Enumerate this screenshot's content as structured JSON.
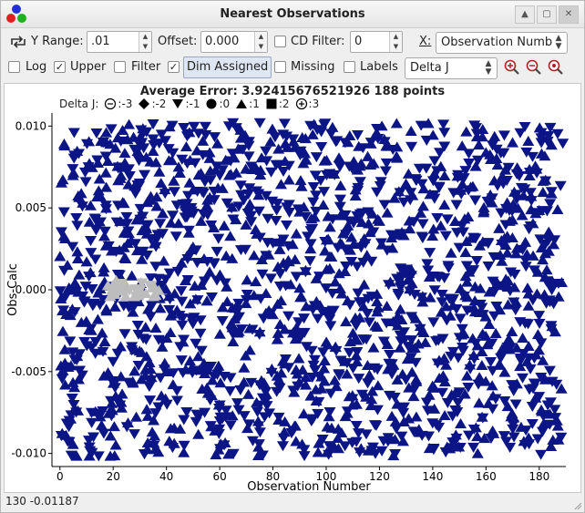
{
  "window": {
    "title": "Nearest Observations",
    "controls": [
      "minimize",
      "maximize",
      "close"
    ]
  },
  "toolbar1": {
    "y_range_label": "Y Range:",
    "y_range_value": ".01",
    "offset_label": "Offset:",
    "offset_value": "0.000",
    "cd_filter_label": "CD Filter:",
    "cd_filter_checked": false,
    "cd_filter_value": "0",
    "x_label": "X:",
    "x_value": "Observation Numb"
  },
  "toolbar2": {
    "log_label": "Log",
    "log_checked": false,
    "upper_label": "Upper",
    "upper_checked": true,
    "filter_label": "Filter",
    "filter_checked": false,
    "dim_label": "Dim Assigned",
    "dim_checked": true,
    "missing_label": "Missing",
    "missing_checked": false,
    "labels_label": "Labels",
    "labels_checked": false,
    "group_value": "Delta J"
  },
  "plot": {
    "header": "Average Error: 3.92415676521926  188 points",
    "legend_title": "Delta J:",
    "legend": [
      {
        "symbol": "circle-minus",
        "label": ":-3"
      },
      {
        "symbol": "diamond",
        "label": ":-2"
      },
      {
        "symbol": "triangle-down",
        "label": ":-1"
      },
      {
        "symbol": "circle",
        "label": ":0"
      },
      {
        "symbol": "triangle-up",
        "label": ":1"
      },
      {
        "symbol": "square",
        "label": ":2"
      },
      {
        "symbol": "circle-plus",
        "label": ":3"
      }
    ]
  },
  "chart_data": {
    "type": "scatter",
    "xlabel": "Observation Number",
    "ylabel": "Obs-Calc",
    "xlim": [
      -3,
      190
    ],
    "ylim": [
      -0.0108,
      0.0108
    ],
    "x_ticks": [
      0,
      20,
      40,
      60,
      80,
      100,
      120,
      140,
      160,
      180
    ],
    "y_ticks": [
      0.01,
      0.005,
      0.0,
      -0.005,
      -0.01
    ],
    "y_tick_labels": [
      "0.010",
      "0.005",
      "0.000",
      "-0.005",
      "-0.010"
    ],
    "point_count": 188,
    "series_colors": {
      "unassigned": "#0b1585",
      "assigned_dim": "#bdbdbd"
    },
    "series": [
      {
        "symbol": "triangle-down",
        "values_summary": "dense field of points spanning x 0-188 and y -0.010 to 0.010"
      },
      {
        "symbol": "triangle-up",
        "values_summary": "dense field of points spanning x 0-188 and y -0.010 to 0.010"
      },
      {
        "symbol": "triangle (dimmed, assigned)",
        "values_summary": "small grey cluster near x 17-38, y ~0.000"
      }
    ]
  },
  "status_bar": {
    "text": "130  -0.01187"
  }
}
